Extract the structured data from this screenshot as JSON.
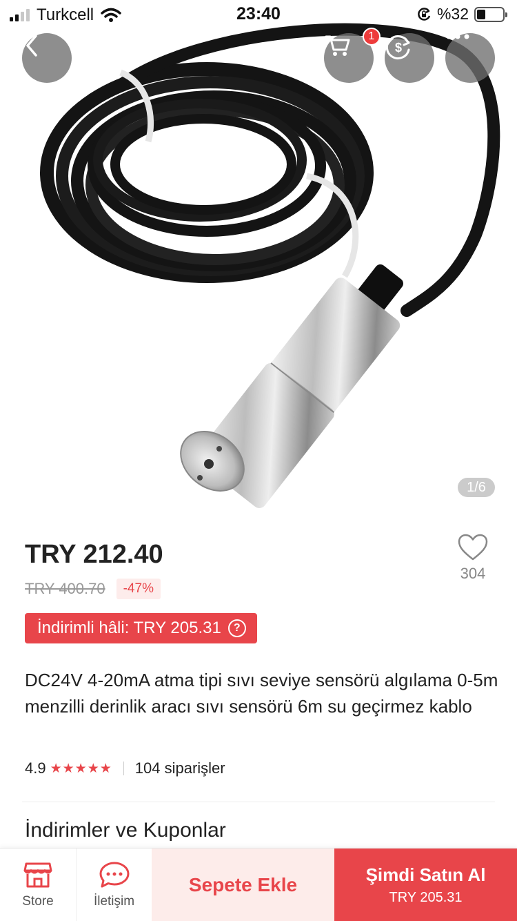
{
  "status_bar": {
    "carrier": "Turkcell",
    "time": "23:40",
    "battery_text": "%32",
    "battery_level": 0.32
  },
  "hero": {
    "image_counter": "1/6",
    "cart_badge": "1",
    "icons": [
      "back-icon",
      "cart-icon",
      "currency-icon",
      "more-icon"
    ]
  },
  "product": {
    "price": "TRY 212.40",
    "old_price": "TRY 400.70",
    "discount": "-47%",
    "wishlist_count": "304",
    "promo_label": "İndirimli hâli: TRY 205.31",
    "promo_help": "?",
    "title": "DC24V 4-20mA atma tipi sıvı seviye sensörü algılama 0-5m menzilli derinlik aracı sıvı sensörü 6m su geçirmez kablo",
    "rating": "4.9",
    "stars": "★★★★★",
    "orders": "104 siparişler"
  },
  "sections": {
    "coupons_title": "İndirimler ve Kuponlar"
  },
  "bottom_bar": {
    "store_label": "Store",
    "contact_label": "İletişim",
    "add_to_cart": "Sepete Ekle",
    "buy_now": "Şimdi Satın Al",
    "buy_now_price": "TRY 205.31"
  },
  "colors": {
    "accent": "#e8454a",
    "accent_light": "#fdecea",
    "badge": "#ee3b3b"
  }
}
